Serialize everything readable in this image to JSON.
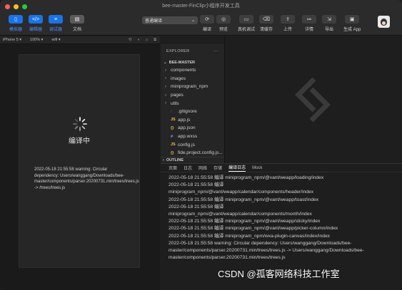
{
  "window": {
    "title": "bee-master-FinClip小程序开发工具"
  },
  "toolbar": {
    "left_buttons": [
      {
        "icon": "phone-icon",
        "label": "模拟器"
      },
      {
        "icon": "code-icon",
        "label": "编辑器"
      },
      {
        "icon": "debug-icon",
        "label": "调试器"
      },
      {
        "icon": "document-icon",
        "label": "文档"
      }
    ],
    "compile_mode": "普通编译",
    "right_buttons": [
      {
        "icon": "compile-icon",
        "label": "编译"
      },
      {
        "icon": "preview-icon",
        "label": "预览"
      },
      {
        "icon": "device-debug-icon",
        "label": "真机调试"
      },
      {
        "icon": "clear-cache-icon",
        "label": "清缓存"
      },
      {
        "icon": "upload-icon",
        "label": "上传"
      },
      {
        "icon": "details-icon",
        "label": "详情"
      },
      {
        "icon": "export-icon",
        "label": "导出"
      },
      {
        "icon": "app-icon",
        "label": "生成 App"
      }
    ]
  },
  "simulator": {
    "device": "iPhone 5 ▾",
    "zoom": "100% ▾",
    "network": "wifi ▾",
    "compiling_text": "编译中",
    "warning_text": "2022-05-18 21:55:58 warning: Circular dependency: Users/wanggang/Downloads/bee-master/components/parser.20200731.min/trees/trees.js -> /trees/trees.js"
  },
  "explorer": {
    "header": "EXPLORER",
    "more": "···",
    "project": "BEE-MASTER",
    "items": [
      {
        "type": "folder",
        "name": "components"
      },
      {
        "type": "folder",
        "name": "images"
      },
      {
        "type": "folder",
        "name": "miniprogram_npm"
      },
      {
        "type": "folder",
        "name": "pages"
      },
      {
        "type": "folder",
        "name": "utils"
      },
      {
        "type": "git",
        "icon": "·",
        "name": ".gitignore"
      },
      {
        "type": "js",
        "icon": "JS",
        "name": "app.js"
      },
      {
        "type": "json",
        "icon": "{}",
        "name": "app.json"
      },
      {
        "type": "wxss",
        "icon": "#",
        "name": "app.wxss"
      },
      {
        "type": "js",
        "icon": "JS",
        "name": "config.js"
      },
      {
        "type": "json",
        "icon": "{}",
        "name": "fide.project.config.js..."
      }
    ],
    "outline": "OUTLINE"
  },
  "debug": {
    "tabs": [
      "页面",
      "日志",
      "网络",
      "存储",
      "编译日志",
      "Mock"
    ],
    "active_tab": 4,
    "logs": [
      "2022-05-18 21:55:58 编译 miniprogram_npm/@vant/weapp/loading/index",
      "2022-05-18 21:55:58 编译",
      "miniprogram_npm/@vant/weapp/calendar/components/header/index",
      "2022-05-18 21:55:58 编译 miniprogram_npm/@vant/weapp/toast/index",
      "2022-05-18 21:55:58 编译",
      "miniprogram_npm/@vant/weapp/calendar/components/month/index",
      "2022-05-18 21:55:58 编译 miniprogram_npm/@vant/weapp/sticky/index",
      "2022-05-18 21:55:58 编译 miniprogram_npm/@vant/weapp/picker-column/index",
      "2022-05-18 21:55:58 编译 miniprogram_npm/wxa-plugin-canvas/index/index",
      "2022-05-18 21:55:58 warning: Circular dependency: Users/wanggang/Downloads/bee-master/components/parser.20200731.min/trees/trees.js -> Users/wanggang/Downloads/bee-master/components/parser.20200731.min/trees/trees.js"
    ]
  },
  "watermark": "CSDN @孤客网络科技工作室",
  "colors": {
    "accent": "#1a73e8",
    "background": "#1e1e1e"
  }
}
